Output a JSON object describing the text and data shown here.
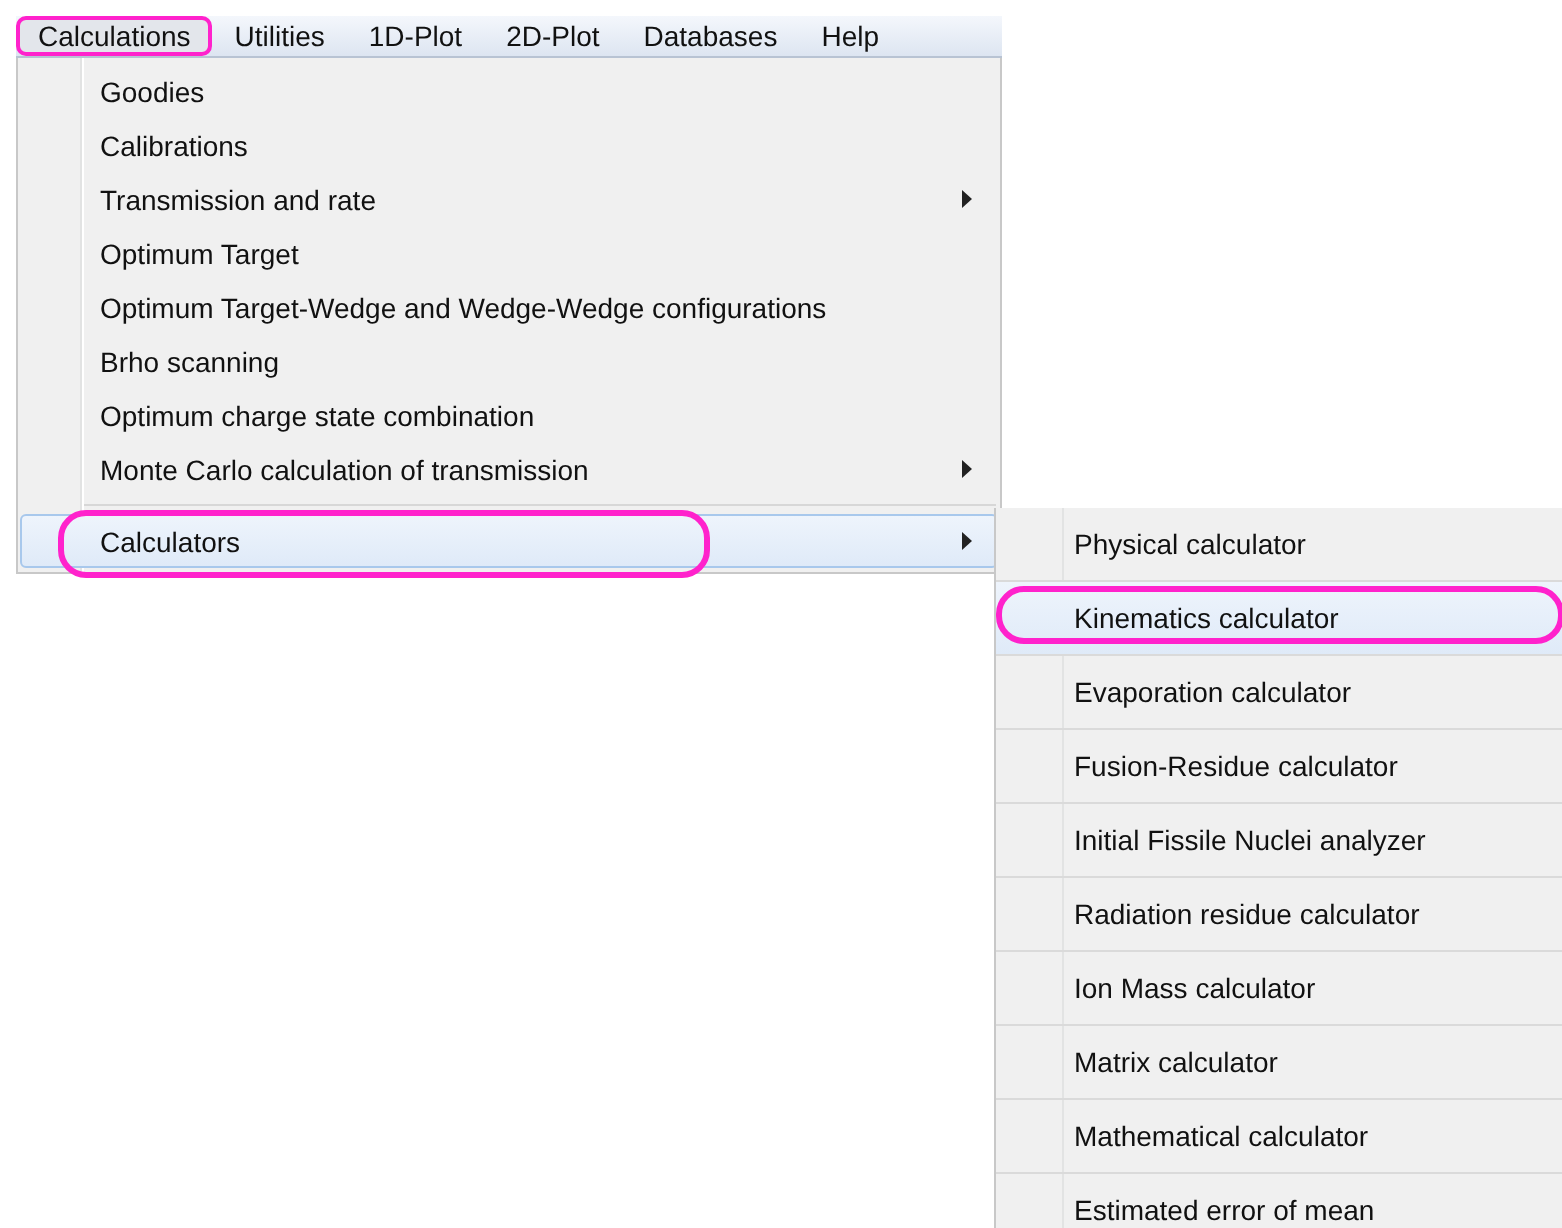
{
  "menubar": [
    {
      "label": "Calculations",
      "selected": true,
      "circled": true
    },
    {
      "label": "Utilities",
      "selected": false,
      "circled": false
    },
    {
      "label": "1D-Plot",
      "selected": false,
      "circled": false
    },
    {
      "label": "2D-Plot",
      "selected": false,
      "circled": false
    },
    {
      "label": "Databases",
      "selected": false,
      "circled": false
    },
    {
      "label": "Help",
      "selected": false,
      "circled": false
    }
  ],
  "menu": [
    {
      "label": "Goodies",
      "submenu": false,
      "selected": false,
      "circled": false
    },
    {
      "label": "Calibrations",
      "submenu": false,
      "selected": false,
      "circled": false
    },
    {
      "label": "Transmission and rate",
      "submenu": true,
      "selected": false,
      "circled": false
    },
    {
      "label": "Optimum Target",
      "submenu": false,
      "selected": false,
      "circled": false
    },
    {
      "label": "Optimum Target-Wedge and Wedge-Wedge configurations",
      "submenu": false,
      "selected": false,
      "circled": false
    },
    {
      "label": "Brho scanning",
      "submenu": false,
      "selected": false,
      "circled": false
    },
    {
      "label": "Optimum charge state combination",
      "submenu": false,
      "selected": false,
      "circled": false
    },
    {
      "label": "Monte Carlo calculation of transmission",
      "submenu": true,
      "selected": false,
      "circled": false
    },
    {
      "kind": "separator"
    },
    {
      "label": "Calculators",
      "submenu": true,
      "selected": true,
      "circled": true
    }
  ],
  "submenu": [
    {
      "label": "Physical  calculator",
      "selected": false,
      "circled": false
    },
    {
      "label": "Kinematics  calculator",
      "selected": true,
      "circled": true
    },
    {
      "label": "Evaporation  calculator",
      "selected": false,
      "circled": false
    },
    {
      "label": "Fusion-Residue  calculator",
      "selected": false,
      "circled": false
    },
    {
      "label": "Initial Fissile Nuclei analyzer",
      "selected": false,
      "circled": false
    },
    {
      "label": "Radiation  residue  calculator",
      "selected": false,
      "circled": false
    },
    {
      "label": "Ion Mass  calculator",
      "selected": false,
      "circled": false
    },
    {
      "label": "Matrix  calculator",
      "selected": false,
      "circled": false
    },
    {
      "label": "Mathematical  calculator",
      "selected": false,
      "circled": false
    },
    {
      "label": "Estimated error of mean",
      "selected": false,
      "circled": false
    }
  ]
}
